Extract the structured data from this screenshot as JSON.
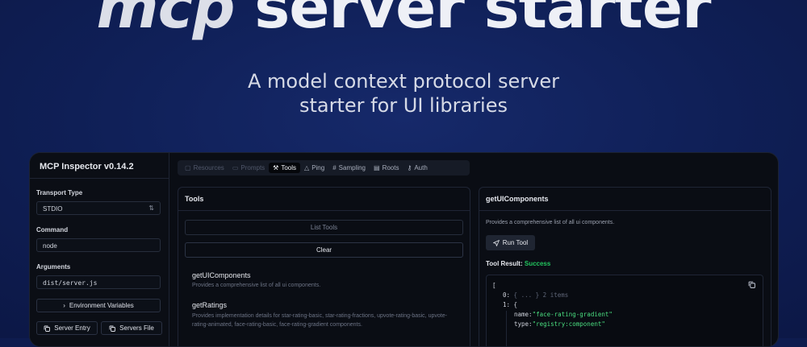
{
  "hero": {
    "title_word1": "mcp",
    "title_rest": "server starter",
    "subtitle_line1": "A model context protocol server",
    "subtitle_line2": "starter for UI libraries"
  },
  "sidebar": {
    "title": "MCP Inspector v0.14.2",
    "transport_label": "Transport Type",
    "transport_value": "STDIO",
    "command_label": "Command",
    "command_value": "node",
    "arguments_label": "Arguments",
    "arguments_value": "dist/server.js",
    "env_button": "Environment Variables",
    "server_entry_button": "Server Entry",
    "servers_file_button": "Servers File"
  },
  "tabs": [
    {
      "label": "Resources",
      "icon": "files-icon"
    },
    {
      "label": "Prompts",
      "icon": "message-icon"
    },
    {
      "label": "Tools",
      "icon": "hammer-icon"
    },
    {
      "label": "Ping",
      "icon": "bell-icon"
    },
    {
      "label": "Sampling",
      "icon": "hash-icon"
    },
    {
      "label": "Roots",
      "icon": "folder-tree-icon"
    },
    {
      "label": "Auth",
      "icon": "key-icon"
    }
  ],
  "tools_panel": {
    "title": "Tools",
    "list_button": "List Tools",
    "clear_button": "Clear",
    "items": [
      {
        "name": "getUIComponents",
        "description": "Provides a comprehensive list of all ui components."
      },
      {
        "name": "getRatings",
        "description": "Provides implementation details for star-rating-basic, star-rating-fractions, upvote-rating-basic, upvote-rating-animated, face-rating-basic, face-rating-gradient components."
      }
    ]
  },
  "detail_panel": {
    "title": "getUIComponents",
    "description": "Provides a comprehensive list of all ui components.",
    "run_button": "Run Tool",
    "result_label": "Tool Result:",
    "result_status": "Success",
    "code": {
      "l1": "[",
      "l2_key": "0:",
      "l2_collapsed": "{ ... }",
      "l2_count": "2 items",
      "l3": "1: {",
      "l4_key": "name:",
      "l4_val": "\"face-rating-gradient\"",
      "l5_key": "type:",
      "l5_val": "\"registry:component\""
    }
  },
  "colors": {
    "background": "#0f1f56",
    "panel": "#0a0d14",
    "success": "#22c55e",
    "string": "#4ade80"
  }
}
